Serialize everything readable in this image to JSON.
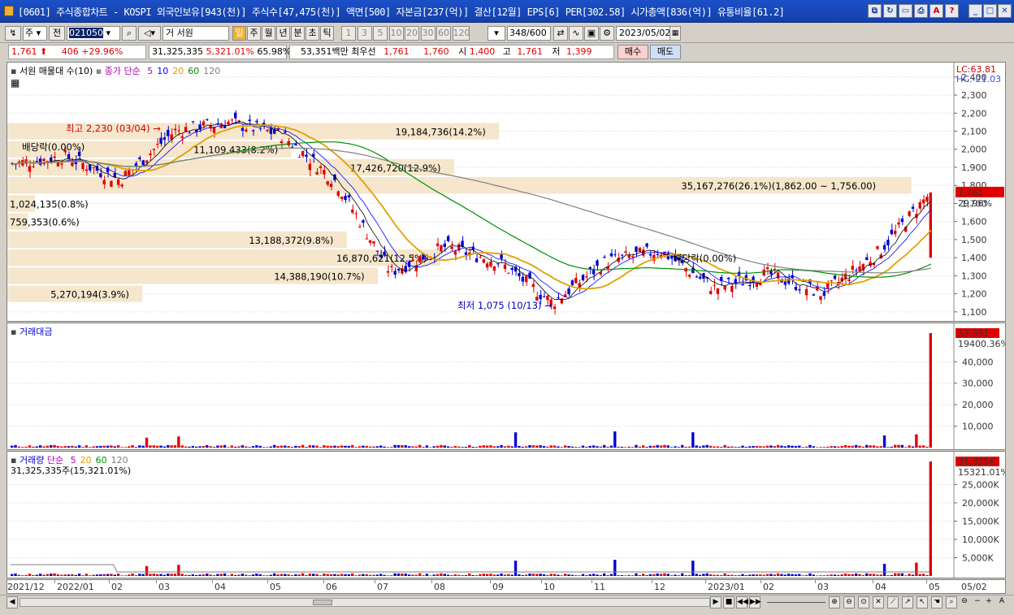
{
  "window": {
    "title": "[0601] 주식종합차트 - KOSPI 외국인보유[943(천)] 주식수[47,475(천)] 액면[500] 자본금[237(억)] 결산[12월] EPS[6] PER[302.58] 시가총액[836(억)] 유통비율[61.2]"
  },
  "toolbar": {
    "period_type": "주",
    "prev_label": "전",
    "code": "021050",
    "market_label": "거",
    "stock_name": "서원",
    "period_buttons": [
      "일",
      "주",
      "월",
      "년",
      "분",
      "초",
      "틱"
    ],
    "active_period": "일",
    "interval_buttons": [
      "1",
      "3",
      "5",
      "10",
      "20",
      "30",
      "60",
      "120"
    ],
    "bar_count": "348",
    "bar_max": "/600",
    "date": "2023/05/02"
  },
  "quote": {
    "price": "1,761",
    "change": "406",
    "change_pct": "+29.96%",
    "volume": "31,325,335",
    "volume_ratio": "5,321.01%",
    "turnover": "65.98%",
    "amount": "53,351백만",
    "best_label": "최우선",
    "ask": "1,761",
    "bid": "1,760",
    "open_label": "시",
    "open": "1,400",
    "high_label": "고",
    "high": "1,761",
    "low_label": "저",
    "low": "1,399",
    "buy_label": "매수",
    "sell_label": "매도"
  },
  "price_panel": {
    "legend_name": "서원 매물대 수(10)",
    "ma_label": "종가 단순",
    "ma_periods": [
      "5",
      "10",
      "20",
      "60",
      "120"
    ],
    "lc": "LC:63.81",
    "hc": "HC:-21.03",
    "current_price_tag": "1,761",
    "current_pct_tag": "29.96%",
    "high_note": "최고 2,230 (03/04)",
    "low_note": "최저 1,075 (10/13)",
    "dividend_note_1": "배당락(0.00%)",
    "dividend_note_2": "배당락(0.00%)",
    "y_ticks": [
      "2,400",
      "2,300",
      "2,200",
      "2,100",
      "2,000",
      "1,900",
      "1,800",
      "1,700",
      "1,600",
      "1,500",
      "1,400",
      "1,300",
      "1,200",
      "1,100"
    ],
    "volume_profile": [
      {
        "label": "19,184,736(14.2%)",
        "price": 2100
      },
      {
        "label": "11,109,433(8.2%)",
        "price": 2000
      },
      {
        "label": "17,426,720(12.9%)",
        "price": 1900
      },
      {
        "label": "35,167,276(26.1%)(1,862.00 ~ 1,756.00)",
        "price": 1800
      },
      {
        "label": "1,024,135(0.8%)",
        "price": 1700
      },
      {
        "label": "759,353(0.6%)",
        "price": 1600
      },
      {
        "label": "13,188,372(9.8%)",
        "price": 1500
      },
      {
        "label": "16,870,621(12.5%)",
        "price": 1400
      },
      {
        "label": "14,388,190(10.7%)",
        "price": 1300
      },
      {
        "label": "5,270,194(3.9%)",
        "price": 1200
      }
    ]
  },
  "amount_panel": {
    "legend_name": "거래대금",
    "current_tag": "53,351",
    "pct_tag": "19400.36%",
    "y_ticks": [
      "40,000",
      "30,000",
      "20,000",
      "10,000"
    ]
  },
  "volume_panel": {
    "legend_name": "거래량",
    "ma_label": "단순",
    "ma_periods": [
      "5",
      "20",
      "60",
      "120"
    ],
    "value_line": "31,325,335주(15,321.01%)",
    "current_tag": "31,325K",
    "pct_tag": "15321.01%",
    "y_ticks": [
      "25,000K",
      "20,000K",
      "15,000K",
      "10,000K",
      "5,000K"
    ]
  },
  "x_axis": {
    "labels": [
      "2021/12",
      "2022/01",
      "02",
      "03",
      "04",
      "05",
      "06",
      "07",
      "08",
      "09",
      "10",
      "11",
      "12",
      "2023/01",
      "02",
      "03",
      "04",
      "05",
      "05/02"
    ]
  },
  "colors": {
    "up": "#e00000",
    "down": "#0000d0",
    "ma5": "#000000",
    "ma10": "#0000ff",
    "ma20": "#e0a000",
    "ma60": "#009000",
    "ma120": "#808080",
    "profile": "#f5e6cc",
    "titlebar": "#1c50c8"
  },
  "chart_data": {
    "type": "line",
    "title": "",
    "xlabel": "",
    "ylabel": "",
    "ylim": [
      1050,
      2480
    ],
    "x": [
      "2021/12",
      "2022/01",
      "02",
      "03",
      "04",
      "05",
      "06",
      "07",
      "08",
      "09",
      "10",
      "11",
      "12",
      "2023/01",
      "02",
      "03",
      "04",
      "05"
    ],
    "series": [
      {
        "name": "종가",
        "values": [
          1920,
          1960,
          1830,
          2100,
          2150,
          2080,
          1820,
          1320,
          1460,
          1380,
          1150,
          1380,
          1440,
          1230,
          1310,
          1200,
          1420,
          1761
        ]
      }
    ],
    "volume_profile_share_pct": [
      14.2,
      8.2,
      12.9,
      26.1,
      0.8,
      0.6,
      9.8,
      12.5,
      10.7,
      3.9
    ]
  }
}
